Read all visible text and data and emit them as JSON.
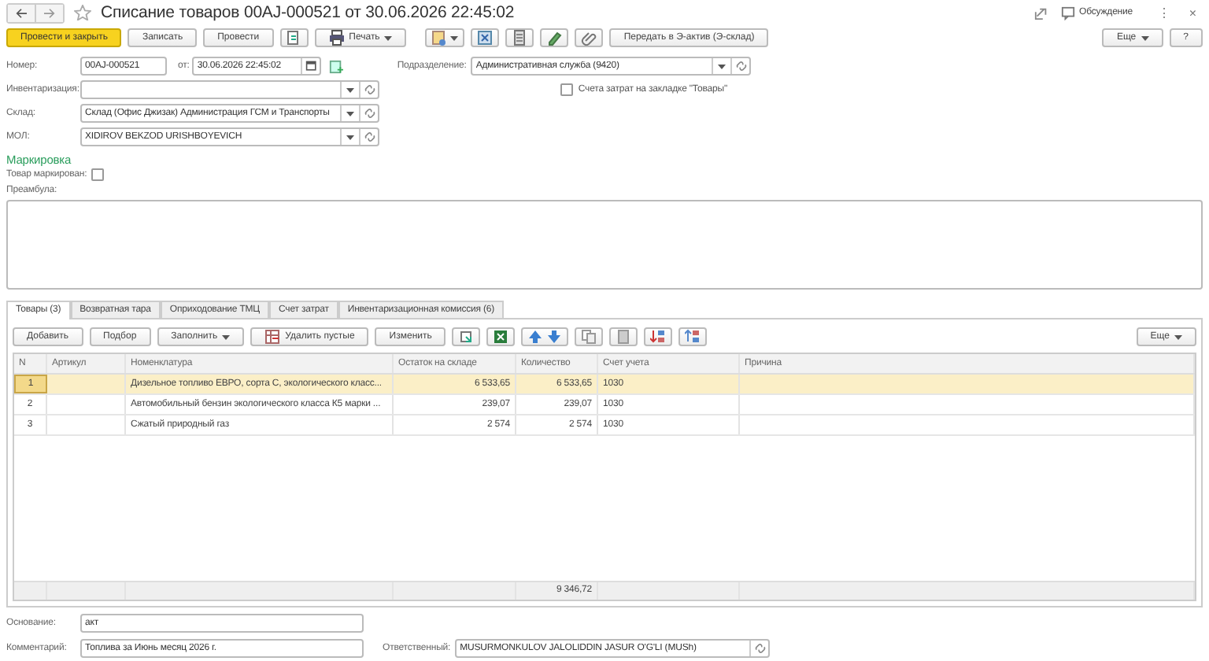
{
  "window": {
    "title": "Списание товаров 00AJ-000521 от 30.06.2026 22:45:02",
    "discussion": "Обсуждение",
    "more": "⋮",
    "close": "×"
  },
  "toolbar": {
    "buttons": [
      {
        "kind": "primary",
        "label": "Провести и закрыть"
      },
      {
        "kind": "plain",
        "label": "Записать"
      },
      {
        "kind": "plain",
        "label": "Провести"
      },
      {
        "kind": "dropdown",
        "label": "Печать"
      },
      {
        "kind": "plain",
        "label": "Передать в Э-актив (Э-склад)"
      }
    ],
    "more": "Еще",
    "help": "?"
  },
  "form": {
    "number": {
      "label": "Номер:",
      "value": "00AJ-000521"
    },
    "date": {
      "label": "от:",
      "value": "30.06.2026 22:45:02"
    },
    "department": {
      "label": "Подразделение:",
      "value": "Административная служба (9420)"
    },
    "inventory": {
      "label": "Инвентаризация:"
    },
    "cost_accounts": {
      "label": "Счета затрат на закладке \"Товары\"",
      "checked": false
    },
    "warehouse": {
      "label": "Склад:",
      "value": "Склад (Офис Джизак) Администрация ГСМ и Транспорты"
    },
    "mol": {
      "label": "МОЛ:",
      "value": "XIDIROV BEKZOD URISHBOYEVICH"
    },
    "marking": {
      "title": "Маркировка",
      "label": "Товар маркирован:",
      "checked": false
    },
    "preamble": {
      "label": "Преамбула:"
    }
  },
  "tabs": [
    {
      "label": "Товары (3)",
      "selected": true
    },
    {
      "label": "Возвратная тара",
      "selected": false
    },
    {
      "label": "Оприходование ТМЦ",
      "selected": false
    },
    {
      "label": "Счет затрат",
      "selected": false
    },
    {
      "label": "Инвентаризационная комиссия (6)",
      "selected": false
    }
  ],
  "table_toolbar": {
    "buttons": [
      {
        "kind": "plain",
        "label": "Добавить"
      },
      {
        "kind": "plain",
        "label": "Подбор"
      },
      {
        "kind": "dropdown",
        "label": "Заполнить"
      },
      {
        "kind": "icon_text",
        "label": "Удалить пустые"
      },
      {
        "kind": "plain",
        "label": "Изменить"
      }
    ],
    "more": "Еще"
  },
  "table": {
    "columns": [
      "N",
      "Артикул",
      "Номенклатура",
      "Остаток на складе",
      "Количество",
      "Счет учета",
      "Причина"
    ],
    "rows": [
      {
        "n": "1",
        "name": "Дизельное топливо ЕВРО, сорта С, экологического класс...",
        "stock": "6 533,65",
        "quantity": "6 533,65",
        "account": "1030",
        "selected": true
      },
      {
        "n": "2",
        "name": "Автомобильный бензин экологического класса К5 марки ...",
        "stock": "239,07",
        "quantity": "239,07",
        "account": "1030",
        "selected": false
      },
      {
        "n": "3",
        "name": "Сжатый природный газ",
        "stock": "2 574",
        "quantity": "2 574",
        "account": "1030",
        "selected": false
      }
    ],
    "total_quantity": "9 346,72"
  },
  "footer": {
    "basis": {
      "label": "Основание:",
      "value": "акт"
    },
    "comment": {
      "label": "Комментарий:",
      "value": "Топлива за Июнь месяц 2026 г."
    },
    "responsible": {
      "label": "Ответственный:",
      "value": "MUSURMONKULOV JALOLIDDIN JASUR O'G'LI (MUSh)"
    }
  }
}
